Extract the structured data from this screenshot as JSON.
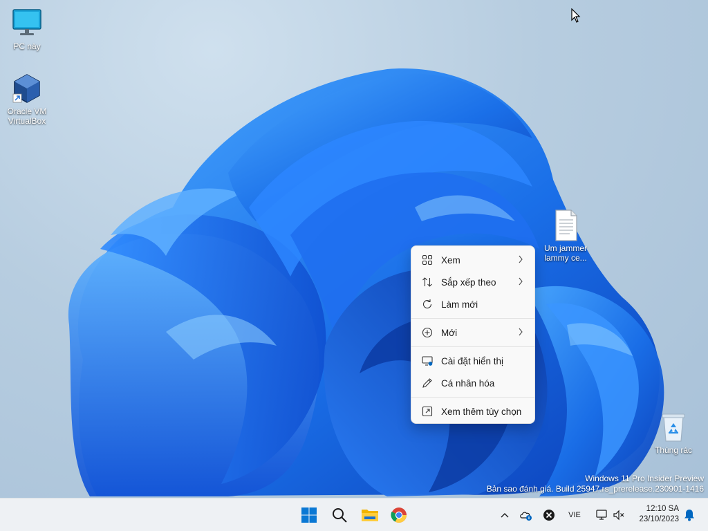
{
  "desktop": {
    "icons": [
      {
        "label": "PC này",
        "icon": "monitor-icon"
      },
      {
        "label": "Oracle VM\nVirtualBox",
        "icon": "virtualbox-icon"
      },
      {
        "label": "Um jammer\nlammy ce...",
        "icon": "text-file-icon"
      },
      {
        "label": "Thùng rác",
        "icon": "recycle-bin-icon"
      }
    ],
    "watermark": {
      "line1": "Windows 11 Pro Insider Preview",
      "line2": "Bản sao đánh giá. Build 25947.rs_prerelease.230901-1416"
    }
  },
  "context_menu": {
    "items": [
      {
        "label": "Xem",
        "icon": "view-grid-icon",
        "submenu": true
      },
      {
        "label": "Sắp xếp theo",
        "icon": "sort-icon",
        "submenu": true
      },
      {
        "label": "Làm mới",
        "icon": "refresh-icon",
        "submenu": false
      },
      {
        "label": "Mới",
        "icon": "new-plus-icon",
        "submenu": true
      },
      {
        "label": "Cài đặt hiển thị",
        "icon": "display-settings-icon",
        "submenu": false
      },
      {
        "label": "Cá nhân hóa",
        "icon": "personalize-pen-icon",
        "submenu": false
      },
      {
        "label": "Xem thêm tùy chọn",
        "icon": "more-options-icon",
        "submenu": false
      }
    ]
  },
  "taskbar": {
    "apps": [
      {
        "name": "start",
        "icon": "windows-start-icon"
      },
      {
        "name": "search",
        "icon": "search-icon"
      },
      {
        "name": "file-explorer",
        "icon": "folder-icon"
      },
      {
        "name": "chrome",
        "icon": "chrome-icon"
      }
    ],
    "tray": {
      "language": "VIE",
      "time": "12:10 SA",
      "date": "23/10/2023"
    }
  },
  "colors": {
    "accent": "#0067c0",
    "taskbar_bg": "#eef1f4",
    "menu_bg": "#f9f9f9",
    "desktop_bg": "#b7cde0"
  }
}
